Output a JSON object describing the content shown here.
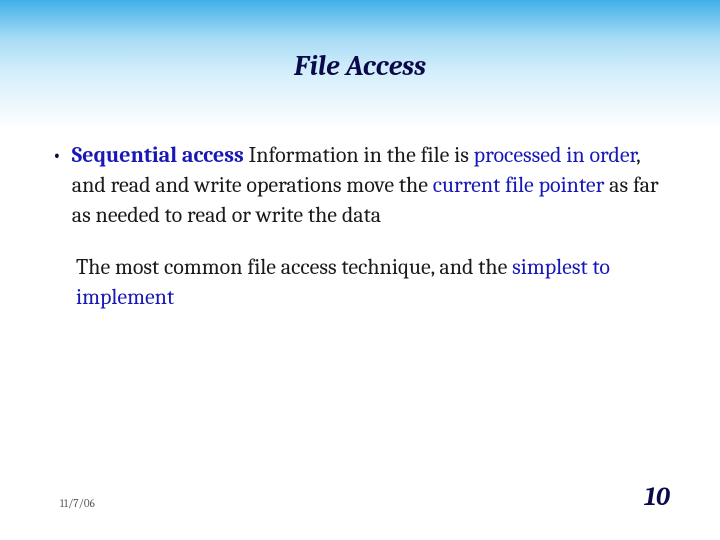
{
  "title": "File Access",
  "bullet": {
    "term": "Sequential access",
    "t1": "  Information in the file is ",
    "h1": "processed in order",
    "t2": ", and read and write operations move the ",
    "h2": "current file pointer",
    "t3": " as far as needed to read or write the data"
  },
  "para2": {
    "t1": "The most common file access technique, and the ",
    "h1": "simplest to implement"
  },
  "footer": {
    "date": "11/7/06",
    "page": "10"
  }
}
